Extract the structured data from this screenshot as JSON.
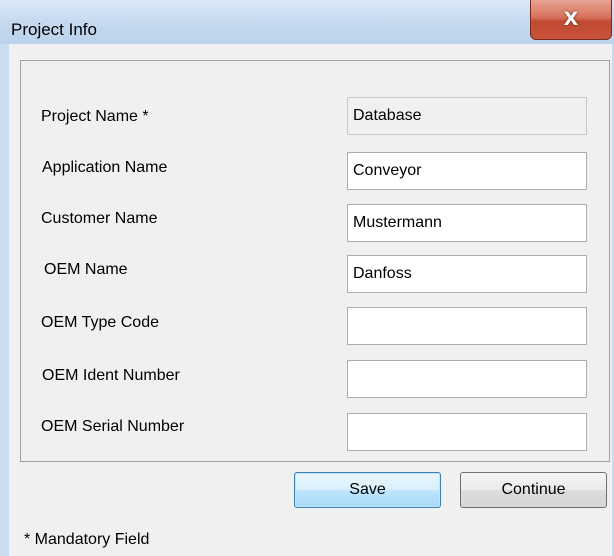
{
  "window": {
    "title": "Project Info",
    "close_glyph": "X"
  },
  "form": {
    "fields": [
      {
        "label": "Project Name *",
        "value": "Database",
        "readonly": true
      },
      {
        "label": "Application Name",
        "value": "Conveyor"
      },
      {
        "label": "Customer Name",
        "value": "Mustermann"
      },
      {
        "label": "OEM Name",
        "value": "Danfoss"
      },
      {
        "label": "OEM Type Code",
        "value": ""
      },
      {
        "label": "OEM Ident Number",
        "value": ""
      },
      {
        "label": "OEM Serial Number",
        "value": ""
      }
    ]
  },
  "buttons": {
    "save_label": "Save",
    "continue_label": "Continue"
  },
  "footer": {
    "note": "* Mandatory Field"
  },
  "colors": {
    "titlebar": "#c5d9ef",
    "close_button": "#c8533a",
    "default_button_border": "#3c7fb1"
  }
}
